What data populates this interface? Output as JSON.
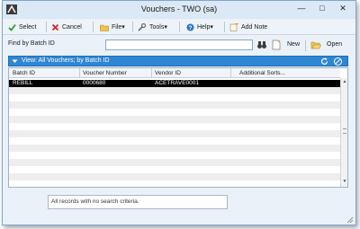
{
  "window": {
    "title": "Vouchers  -  TWO (sa)"
  },
  "toolbar": {
    "select": "Select",
    "cancel": "Cancel",
    "file": "File▾",
    "tools": "Tools▾",
    "help": "Help▾",
    "add_note": "Add Note"
  },
  "find": {
    "label": "Find by Batch ID",
    "value": "",
    "new": "New",
    "open": "Open"
  },
  "view": {
    "label": "View: All Vouchers; by Batch ID"
  },
  "grid": {
    "columns": [
      "Batch ID",
      "Voucher Number",
      "Vendor ID",
      "Additional Sorts..."
    ],
    "rows": [
      [
        "REBILL",
        "0000680",
        "ACETRAVE0001"
      ]
    ]
  },
  "status": {
    "text": "All records with no search criteria."
  },
  "colors": {
    "accent": "#2f86d2",
    "selected_row": "#000000",
    "window_bg": "#eaf1f8"
  }
}
